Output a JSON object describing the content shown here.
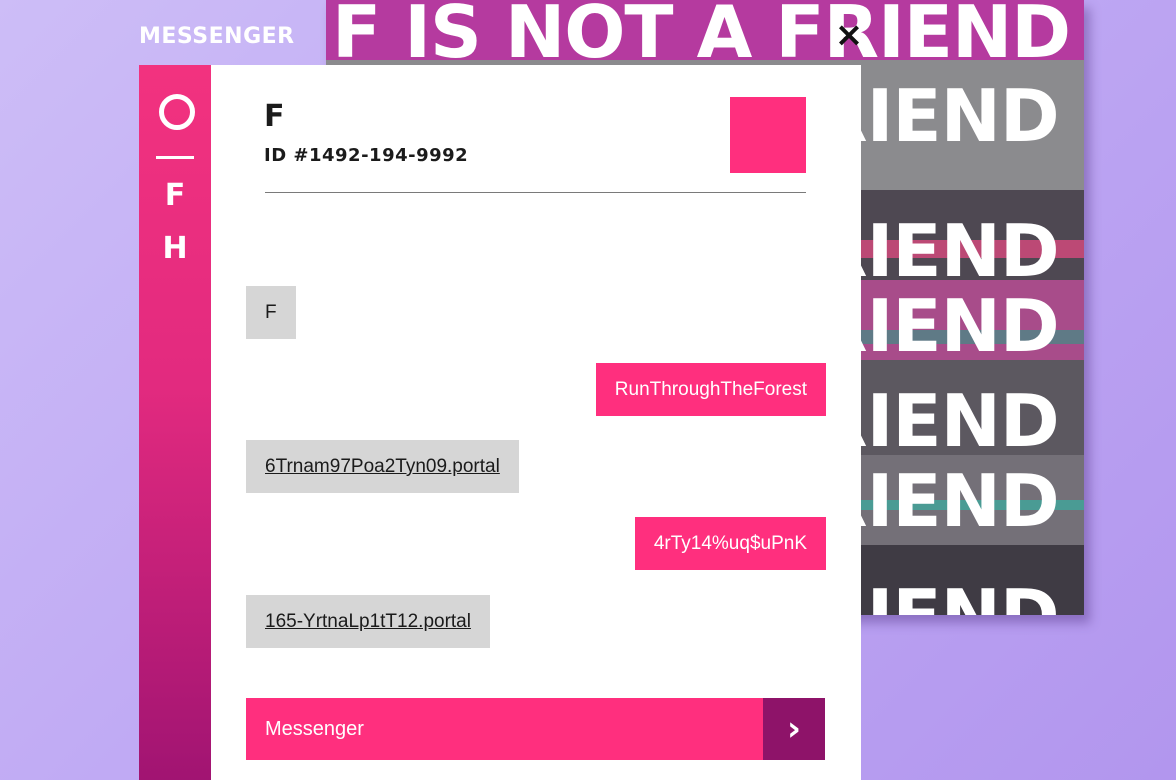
{
  "app": {
    "title": "MESSENGER"
  },
  "background_art": {
    "words": [
      "F IS NOT A FRIEND",
      "FRIEND",
      "FRIEND",
      "FRIEND",
      "FRIEND",
      "FRIEND",
      "FRIEND"
    ]
  },
  "window": {
    "close_glyph": "×"
  },
  "sidebar": {
    "items": [
      {
        "label": "",
        "icon": "ring-icon"
      },
      {
        "label": "F"
      },
      {
        "label": "H"
      }
    ]
  },
  "contact": {
    "name": "F",
    "id": "ID #1492-194-9992",
    "avatar_color": "#ff2f7e"
  },
  "messages": [
    {
      "direction": "in",
      "text": "F",
      "link": false
    },
    {
      "direction": "out",
      "text": "RunThroughTheForest",
      "link": false
    },
    {
      "direction": "in",
      "text": "6Trnam97Poa2Tyn09.portal",
      "link": true
    },
    {
      "direction": "out",
      "text": "4rTy14%uq$uPnK",
      "link": false
    },
    {
      "direction": "in",
      "text": "165-YrtnaLp1tT12.portal",
      "link": true
    }
  ],
  "composer": {
    "placeholder": "Messenger",
    "value": "",
    "send_icon": "chevron-right-icon"
  },
  "colors": {
    "accent": "#ff2f7e",
    "send_button": "#8e1369",
    "incoming_bubble": "#d6d6d6"
  }
}
